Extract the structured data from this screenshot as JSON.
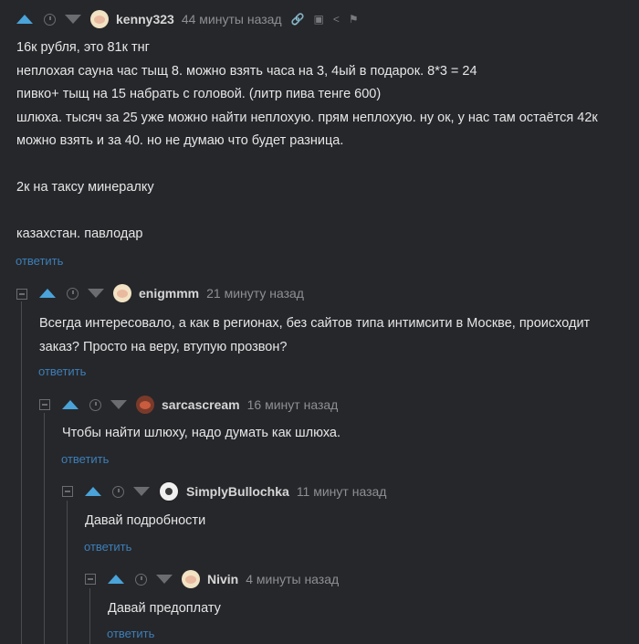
{
  "comments": [
    {
      "username": "kenny323",
      "time": "44 минуты назад",
      "lines": [
        "16к рубля,  это 81к тнг",
        "неплохая сауна  час тыщ 8. можно взять часа на 3, 4ый в подарок. 8*3 = 24",
        "пивко+  тыщ на 15 набрать с головой. (литр пива тенге 600)",
        "шлюха. тысяч за 25 уже можно найти неплохую. прям неплохую. ну ок, у нас там остаётся 42к",
        "можно взять и за 40. но не думаю что будет разница.",
        "",
        "2к на таксу минералку",
        "",
        "казахстан. павлодар"
      ],
      "reply": "ответить"
    },
    {
      "username": "enigmmm",
      "time": "21 минуту назад",
      "lines": [
        "Всегда интересовало, а как в регионах, без сайтов типа интимсити в Москве, происходит",
        "заказ? Просто на веру, втупую прозвон?"
      ],
      "reply": "ответить"
    },
    {
      "username": "sarcascream",
      "time": "16 минут назад",
      "lines": [
        "Чтобы найти шлюху, надо думать как шлюха."
      ],
      "reply": "ответить"
    },
    {
      "username": "SimplyBullochka",
      "time": "11 минут назад",
      "lines": [
        "Давай подробности"
      ],
      "reply": "ответить"
    },
    {
      "username": "Nivin",
      "time": "4 минуты назад",
      "lines": [
        "Давай предоплату"
      ],
      "reply": "ответить"
    }
  ],
  "icons": {
    "upvote": "upvote-icon",
    "downvote": "downvote-icon",
    "clock": "clock-icon",
    "link": "link-icon",
    "save": "save-icon",
    "share": "share-icon",
    "flag": "flag-icon",
    "collapse": "collapse-icon"
  },
  "colors": {
    "background": "#26272b",
    "accent": "#4aa3d9",
    "reply": "#3c7fb8"
  }
}
